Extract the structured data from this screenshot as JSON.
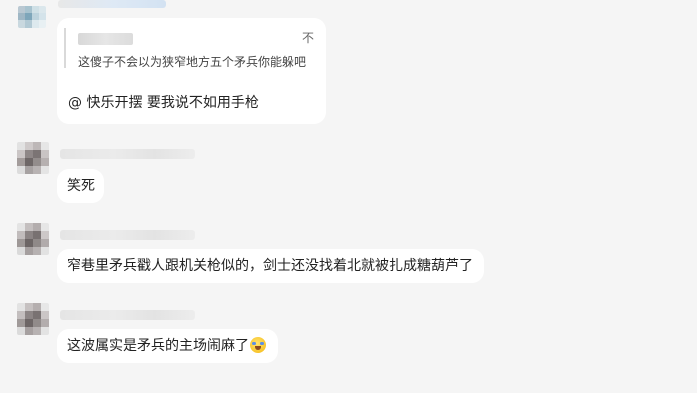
{
  "messages": [
    {
      "quote": {
        "text": "这傻子不会以为狭窄地方五个矛兵你能躲吧",
        "icon_glyph": "不",
        "icon": "collapse-quote-icon"
      },
      "text": "@ 快乐开摆 要我说不如用手枪"
    },
    {
      "text": "笑死"
    },
    {
      "text": "窄巷里矛兵戳人跟机关枪似的，剑士还没找着北就被扎成糖葫芦了"
    },
    {
      "text": "这波属实是矛兵的主场闹麻了",
      "emoji": "tears-of-joy-emoji"
    }
  ],
  "colors": {
    "background": "#f5f5f5",
    "bubble": "#ffffff",
    "text": "#222222"
  }
}
